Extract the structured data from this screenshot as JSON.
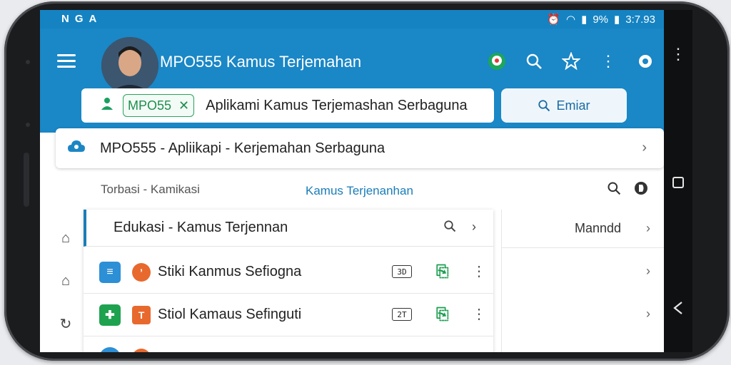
{
  "status": {
    "left_icons": [
      "N",
      "G",
      "A"
    ],
    "right_text": "9%",
    "time": "3:7.93"
  },
  "appbar": {
    "title": "MPO555 Kamus Terjemahan",
    "icons": [
      "chat-icon",
      "search-icon",
      "star-icon",
      "more-icon",
      "settings-icon"
    ]
  },
  "search": {
    "chip_label": "MPO55",
    "query": "Aplikami Kamus Terjemashan Serbaguna",
    "button_label": "Emiar"
  },
  "result": {
    "text": "MPO555 - Apliikapi - Kerjemahan Serbaguna"
  },
  "section": {
    "label": "Torbasi - Kamikasi",
    "tab": "Kamus Terjenanhan"
  },
  "list": {
    "header": "Edukasi - Kamus Terjennan",
    "rows": [
      {
        "label": "Stiki Kanmus Sefiogna",
        "kbd": "3D",
        "badge_color": "#2d8fd5",
        "sub_color": "#e8692d",
        "badge": "≡",
        "sub": "’"
      },
      {
        "label": "Stiol Kamaus Sefinguti",
        "kbd": "2T",
        "badge_color": "#1fa24f",
        "sub_color": "#e8692d",
        "badge": "✚",
        "sub": "T"
      }
    ]
  },
  "side": {
    "rows": [
      {
        "label": "Manndd"
      },
      {
        "label": ""
      },
      {
        "label": ""
      }
    ]
  },
  "colors": {
    "primary": "#1a87c6",
    "accent_green": "#1e9e52",
    "accent_orange": "#e8692d"
  }
}
